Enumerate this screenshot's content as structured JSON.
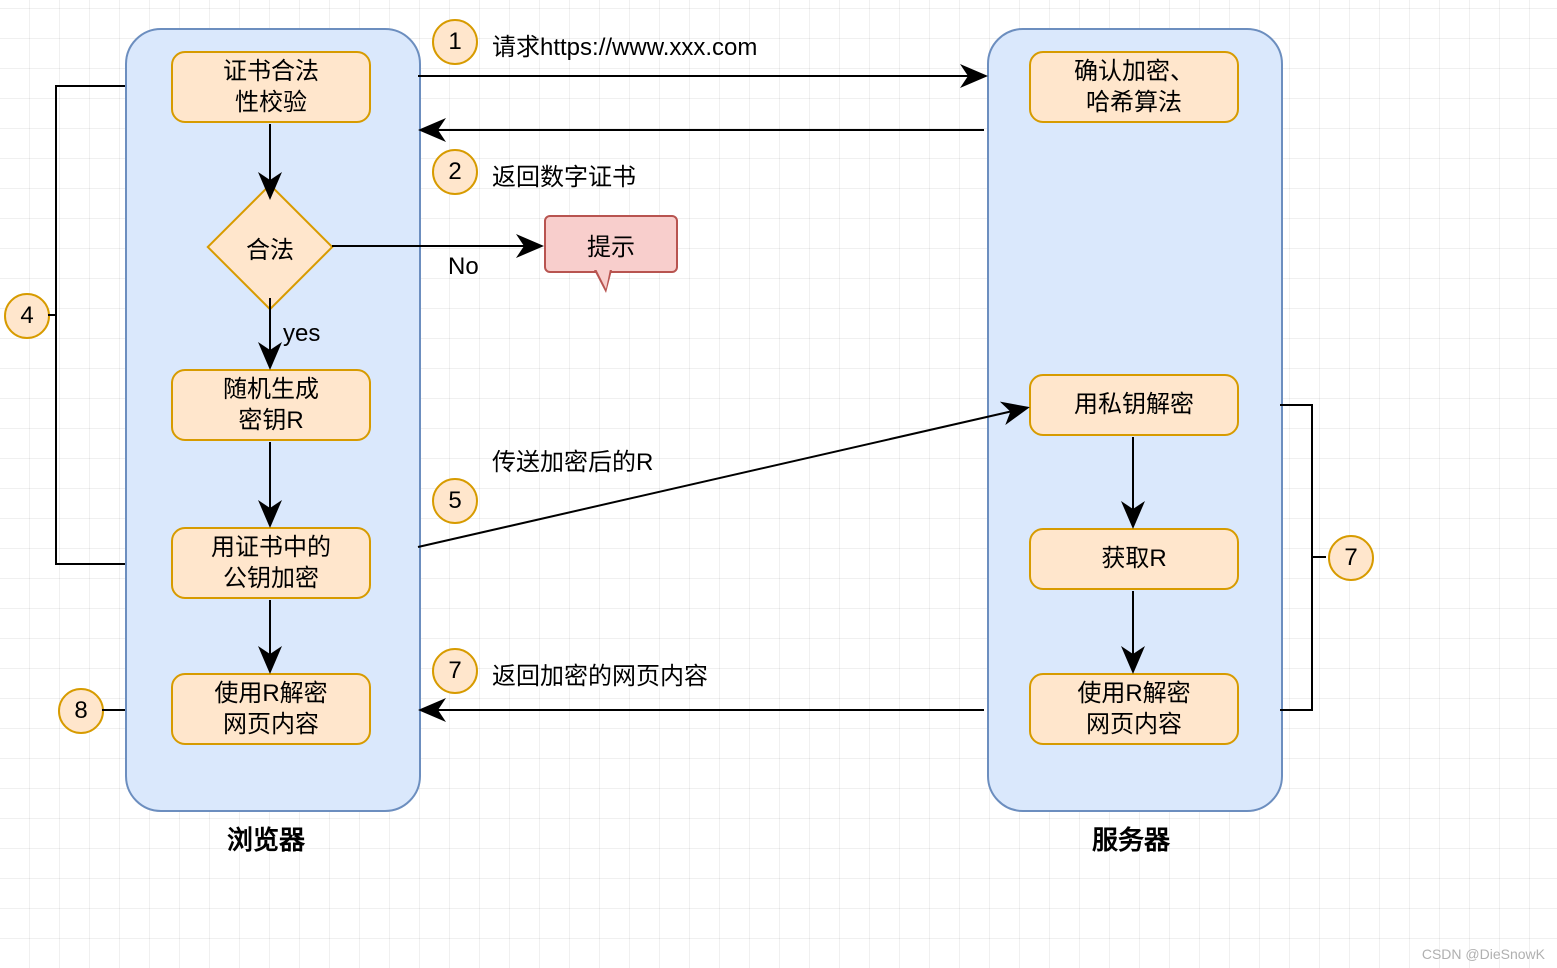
{
  "panes": {
    "browser": {
      "label": "浏览器"
    },
    "server": {
      "label": "服务器"
    }
  },
  "browserNodes": {
    "certCheck": "证书合法\n性校验",
    "decision": "合法",
    "genKey": "随机生成\n密钥R",
    "encrypt": "用证书中的\n公钥加密",
    "decryptPage": "使用R解密\n网页内容"
  },
  "serverNodes": {
    "confirmAlgo": "确认加密、\n哈希算法",
    "decryptPriv": "用私钥解密",
    "getR": "获取R",
    "encodePage": "使用R解密\n网页内容"
  },
  "messages": {
    "m1": {
      "badge": "1",
      "text": "请求https://www.xxx.com"
    },
    "m2": {
      "badge": "2",
      "text": "返回数字证书"
    },
    "m5": {
      "badge": "5",
      "text": "传送加密后的R"
    },
    "m7": {
      "badge": "7",
      "text": "返回加密的网页内容"
    }
  },
  "sideBadges": {
    "left4": "4",
    "left8": "8",
    "right7": "7"
  },
  "decisionLabels": {
    "yes": "yes",
    "no": "No"
  },
  "callout": "提示",
  "watermark": "CSDN @DieSnowK"
}
